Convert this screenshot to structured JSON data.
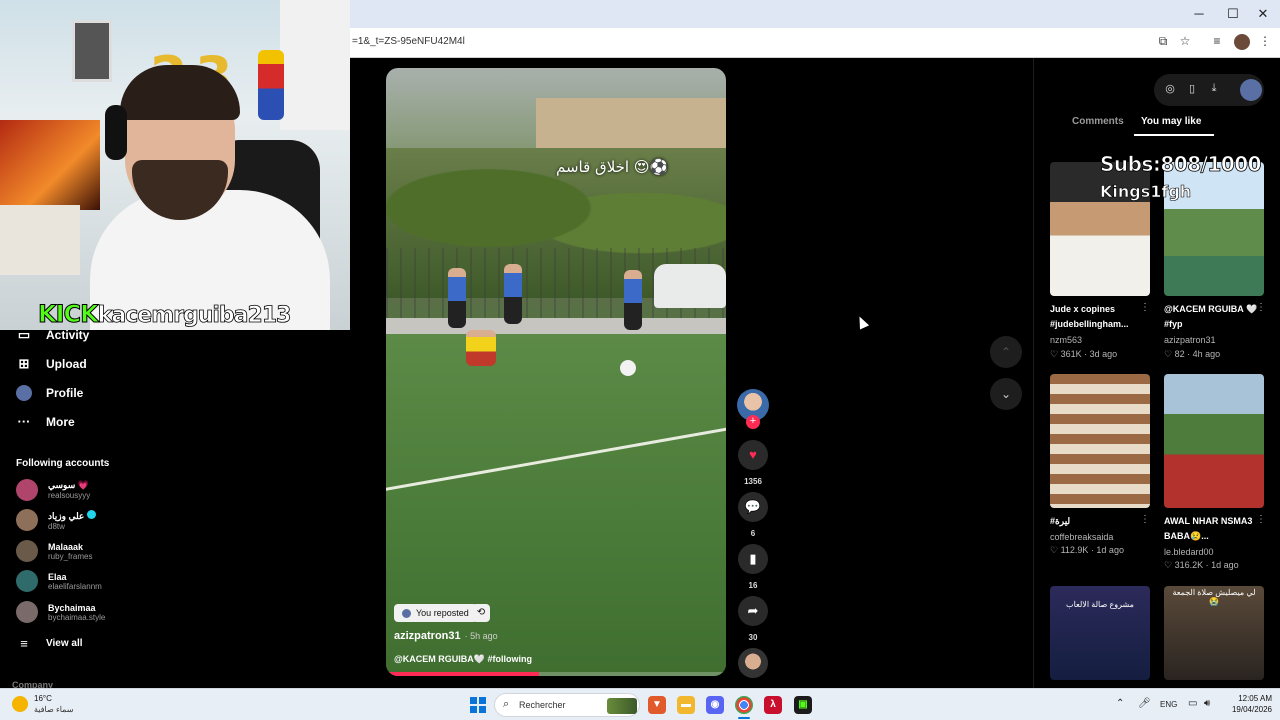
{
  "browser": {
    "url": "=1&_t=ZS-95eNFU42M4l",
    "window_controls": [
      "─",
      "☐",
      "✕"
    ]
  },
  "stream": {
    "kick_label": "KICK",
    "streamer_name": "kacemrguiba213"
  },
  "sidebar": {
    "items": [
      {
        "label": "Activity",
        "icon": "bell-icon"
      },
      {
        "label": "Upload",
        "icon": "plus-square-icon"
      },
      {
        "label": "Profile",
        "icon": "profile-icon"
      },
      {
        "label": "More",
        "icon": "more-dots-icon"
      }
    ],
    "following_title": "Following accounts",
    "accounts": [
      {
        "name": "سوسي 💗",
        "username": "realsousyyy",
        "color": "#b0456c"
      },
      {
        "name": "علي وزياد",
        "username": "d8tw",
        "color": "#8d6f5a",
        "verified": true
      },
      {
        "name": "Malaaak",
        "username": "ruby_frames",
        "color": "#6a5a4a"
      },
      {
        "name": "Elaa",
        "username": "elaelifarslannm",
        "color": "#2f6b6b"
      },
      {
        "name": "Bychaimaa",
        "username": "bychaimaa.style",
        "color": "#7a6a6a"
      }
    ],
    "view_all": "View all",
    "company": "Company"
  },
  "video": {
    "overlay_text": "اخلاق قاسم 😍⚽",
    "reposted_label": "You reposted",
    "author": "azizpatron31",
    "posted_ago": "· 5h ago",
    "caption": "@KACEM RGUIBA🤍 #following",
    "progress_fraction": 0.45
  },
  "actions": {
    "likes": "1356",
    "comments": "6",
    "saves": "16",
    "shares": "30"
  },
  "right_panel": {
    "tabs": [
      "Comments",
      "You may like"
    ],
    "active_tab": "You may like",
    "subs_overlay": "Subs:808/1000",
    "kings_overlay": "Kings1fgh",
    "cards": [
      {
        "title": "Jude x copines #judebellingham...",
        "user": "nzm563",
        "stats": "♡ 361K · 3d ago"
      },
      {
        "title": "@KACEM RGUIBA 🤍 #fyp",
        "user": "azizpatron31",
        "stats": "♡ 82 · 4h ago"
      },
      {
        "title": "#ليرة",
        "user": "coffebreaksaida",
        "stats": "♡ 112.9K · 1d ago"
      },
      {
        "title": "AWAL NHAR NSMA3 BABA😢...",
        "user": "le.bledard00",
        "stats": "♡ 316.2K · 1d ago"
      },
      {
        "title": "",
        "user": "",
        "stats": "",
        "thumb_text": "مشروع صالة الالعاب"
      },
      {
        "title": "",
        "user": "",
        "stats": "",
        "thumb_text": "لي ميصليش صلاة الجمعة😭"
      }
    ]
  },
  "taskbar": {
    "weather_temp": "16°C",
    "weather_desc": "سماء صافية",
    "search_label": "Rechercher",
    "lang": "ENG",
    "time": "12:05 AM",
    "date": "19/04/2026"
  },
  "colors": {
    "accent": "#fe2c55",
    "kick_green": "#53fc18"
  }
}
